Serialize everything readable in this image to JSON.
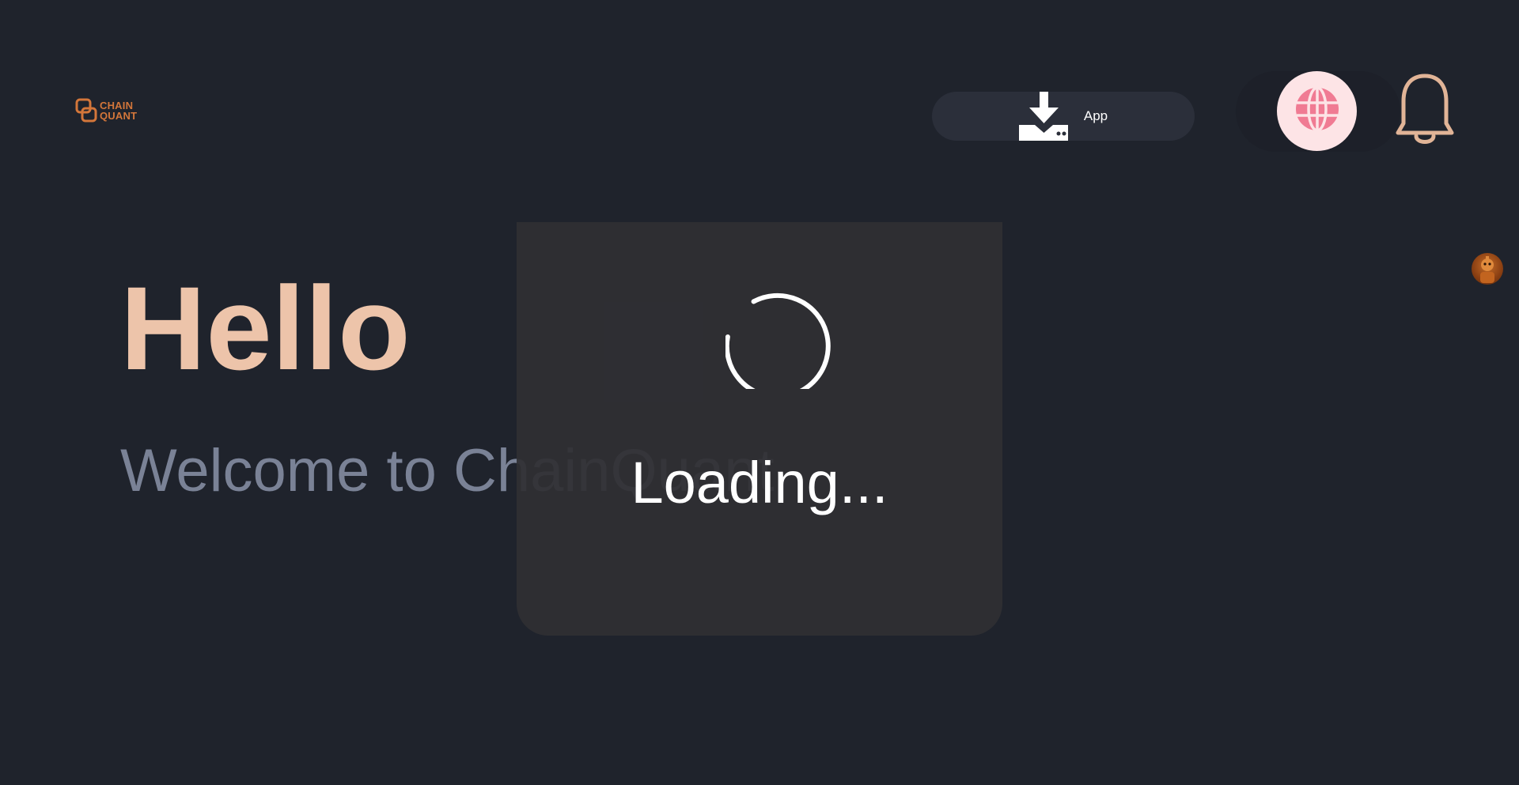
{
  "header": {
    "logo": {
      "line1": "CHAIN",
      "line2": "QUANT",
      "icon": "chainquant-logo-icon",
      "color": "#d3763a"
    },
    "app_button": {
      "label": "App",
      "icon": "download-icon"
    },
    "language_button": {
      "icon": "globe-icon",
      "background": "#fde4e6",
      "icon_color": "#f07b93"
    },
    "notification_button": {
      "icon": "bell-icon",
      "color": "#e1b497"
    },
    "avatar": {
      "icon": "robot-avatar-icon"
    }
  },
  "hero": {
    "title": "Hello",
    "subtitle": "Welcome to ChainQuant"
  },
  "loading": {
    "text": "Loading...",
    "icon": "spinner-icon"
  },
  "colors": {
    "background": "#1f232c",
    "accent": "#edc4aa",
    "muted_text": "#7a8296",
    "panel": "#2f2f33"
  }
}
